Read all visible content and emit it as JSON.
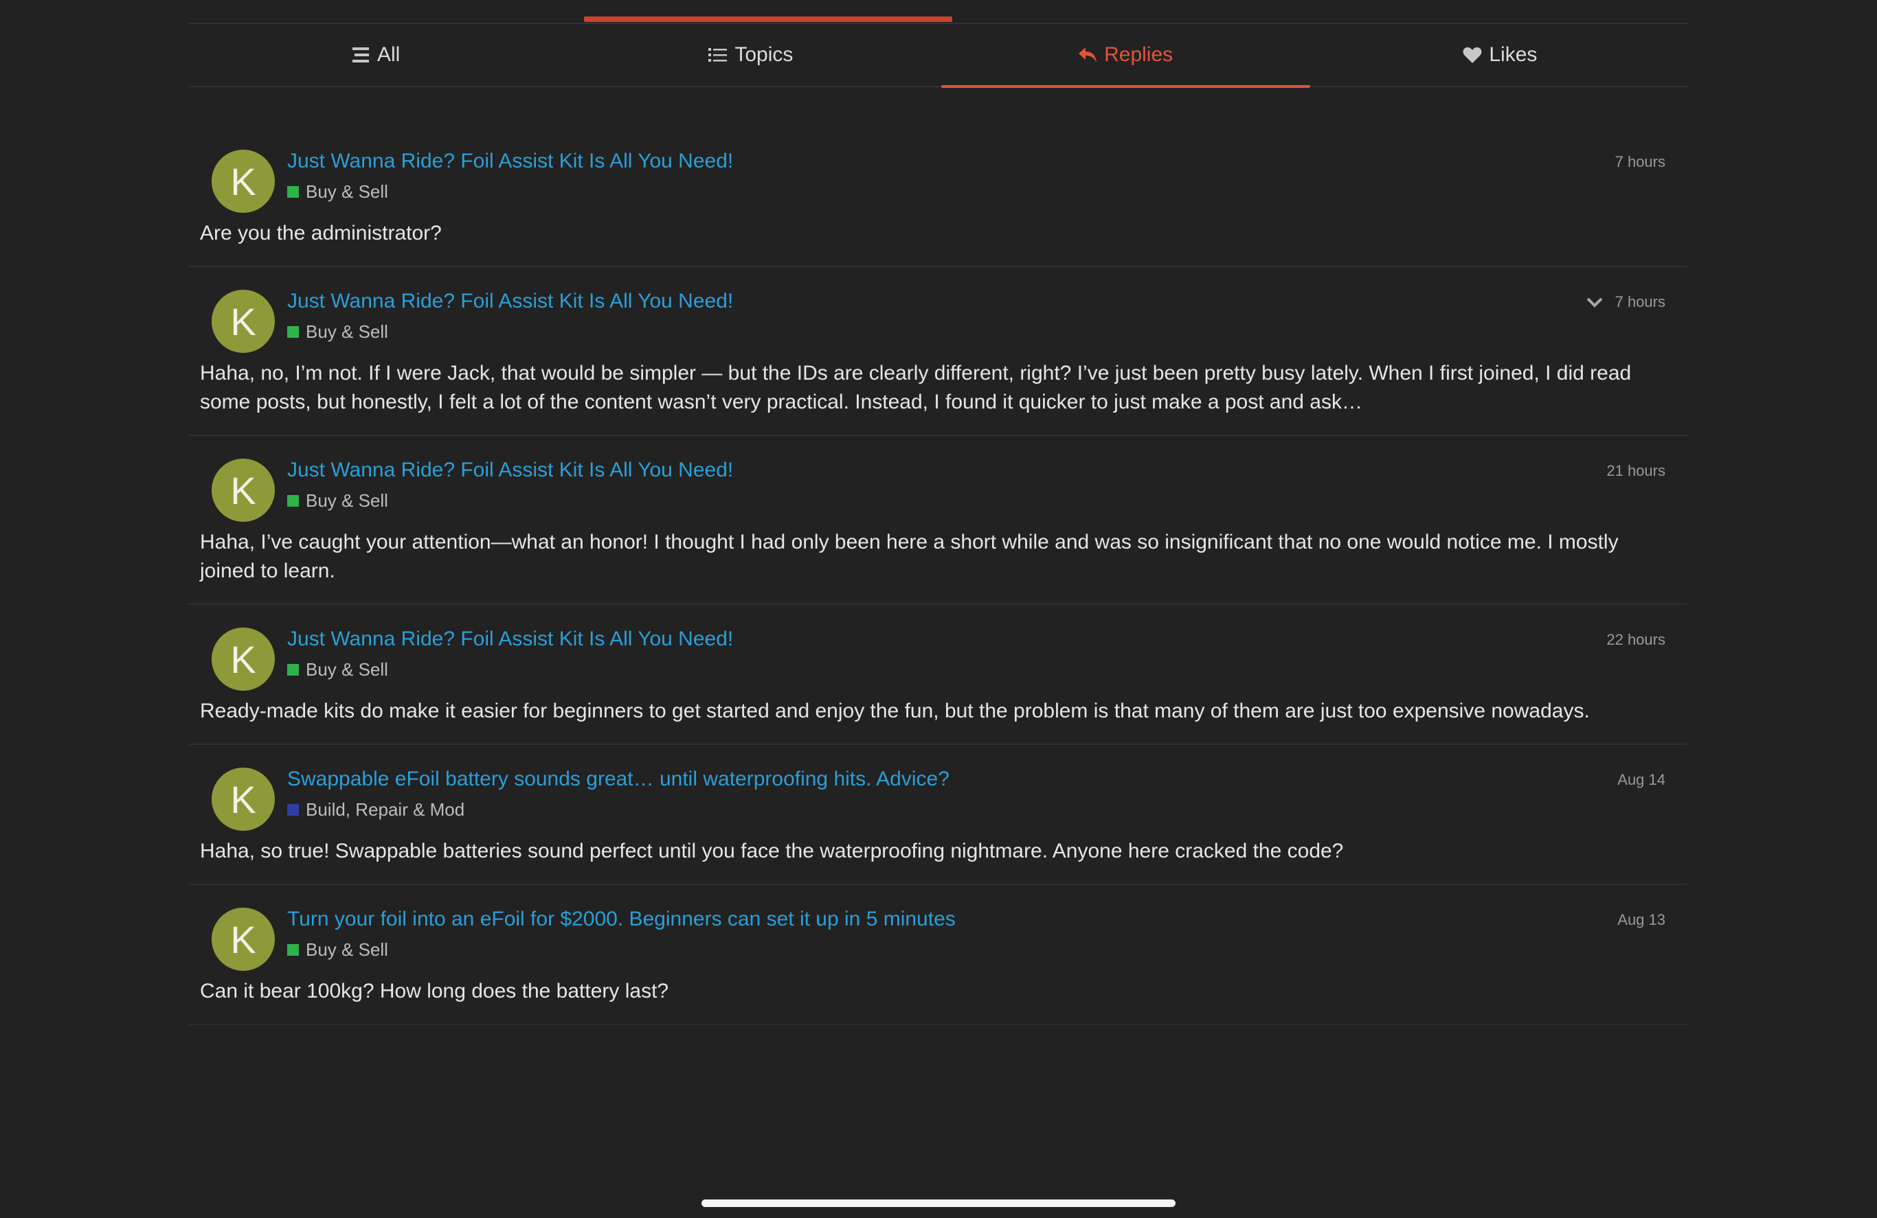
{
  "colors": {
    "background": "#222222",
    "accent": "#e2543b",
    "link": "#2a9fd8",
    "avatar": "#8e9a3a",
    "cat_buy_sell": "#2db34a",
    "cat_build": "#2f3ea6"
  },
  "tabs": [
    {
      "label": "All",
      "icon": "bars-icon"
    },
    {
      "label": "Topics",
      "icon": "list-icon"
    },
    {
      "label": "Replies",
      "icon": "reply-icon"
    },
    {
      "label": "Likes",
      "icon": "heart-icon"
    }
  ],
  "active_tab": "Replies",
  "items": [
    {
      "avatar": "K",
      "title": "Just Wanna Ride? Foil Assist Kit Is All You Need!",
      "category": "Buy & Sell",
      "time": "7 hours",
      "body": "Are you the administrator?"
    },
    {
      "avatar": "K",
      "title": "Just Wanna Ride? Foil Assist Kit Is All You Need!",
      "category": "Buy & Sell",
      "time": "7 hours",
      "body": "Haha, no, I’m not. If I were Jack, that would be simpler — but the IDs are clearly different, right? I’ve just been pretty busy lately. When I first joined, I did read some posts, but honestly, I felt a lot of the content wasn’t very practical. Instead, I found it quicker to just make a post and ask…"
    },
    {
      "avatar": "K",
      "title": "Just Wanna Ride? Foil Assist Kit Is All You Need!",
      "category": "Buy & Sell",
      "time": "21 hours",
      "body": "Haha, I’ve caught your attention—what an honor! I thought I had only been here a short while and was so insignificant that no one would notice me. I mostly joined to learn."
    },
    {
      "avatar": "K",
      "title": "Just Wanna Ride? Foil Assist Kit Is All You Need!",
      "category": "Buy & Sell",
      "time": "22 hours",
      "body": "Ready-made kits do make it easier for beginners to get started and enjoy the fun, but the problem is that many of them are just too expensive nowadays."
    },
    {
      "avatar": "K",
      "title": "Swappable eFoil battery sounds great… until waterproofing hits. Advice?",
      "category": "Build, Repair & Mod",
      "time": "Aug 14",
      "body": "Haha, so true! Swappable batteries sound perfect until you face the waterproofing nightmare. Anyone here cracked the code?"
    },
    {
      "avatar": "K",
      "title": "Turn your foil into an eFoil for $2000. Beginners can set it up in 5 minutes",
      "category": "Buy & Sell",
      "time": "Aug 13",
      "body": "Can it bear 100kg? How long does the battery last?"
    }
  ]
}
